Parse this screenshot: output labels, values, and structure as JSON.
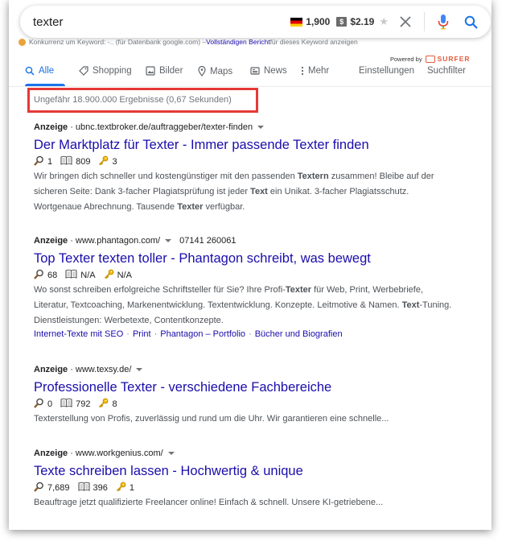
{
  "search": {
    "query": "texter",
    "volume": "1,900",
    "cpc": "$2.19",
    "cpc_badge": "$"
  },
  "competition": {
    "text": "Konkurrenz um Keyword: -.. (für Datenbank google.com) – ",
    "link": "Vollständigen Bericht",
    "suffix": " für dieses Keyword anzeigen"
  },
  "powered_by": {
    "label": "Powered by",
    "brand": "SURFER"
  },
  "tabs": [
    {
      "label": "Alle",
      "icon": "search-icon",
      "active": true
    },
    {
      "label": "Shopping",
      "icon": "tag-icon"
    },
    {
      "label": "Bilder",
      "icon": "image-icon"
    },
    {
      "label": "Maps",
      "icon": "map-pin-icon"
    },
    {
      "label": "News",
      "icon": "news-icon"
    },
    {
      "label": "Mehr",
      "icon": "more-vert-icon"
    }
  ],
  "tools": {
    "settings": "Einstellungen",
    "search_tools": "Suchfilter"
  },
  "stats": "Ungefähr 18.900.000 Ergebnisse (0,67 Sekunden)",
  "results": [
    {
      "label": "Anzeige",
      "url": "ubnc.textbroker.de/auftraggeber/texter-finden",
      "phone": "",
      "title": "Der Marktplatz für Texter - Immer passende Texter finden",
      "metrics": {
        "search": "1",
        "book": "809",
        "key": "3"
      },
      "description": "Wir bringen dich schneller und kostengünstiger mit den passenden <b>Textern</b> zusammen! Bleibe auf der sicheren Seite: Dank 3-facher Plagiatsprüfung ist jeder <b>Text</b> ein Unikat. 3-facher Plagiatsschutz. Wortgenaue Abrechnung. Tausende <b>Texter</b> verfügbar.",
      "sitelinks": []
    },
    {
      "label": "Anzeige",
      "url": "www.phantagon.com/",
      "phone": "07141 260061",
      "title": "Top Texter texten toller - Phantagon schreibt, was bewegt",
      "metrics": {
        "search": "68",
        "book": "N/A",
        "key": "N/A"
      },
      "description": "Wo sonst schreiben erfolgreiche Schriftsteller für Sie? Ihre Profi-<b>Texter</b> für Web, Print, Werbebriefe, Literatur, Textcoaching, Markenentwicklung. Textentwicklung. Konzepte. Leitmotive &amp; Namen. <b>Text</b>-Tuning. Dienstleistungen: Werbetexte, Contentkonzepte.",
      "sitelinks": [
        "Internet-Texte mit SEO",
        "Print",
        "Phantagon – Portfolio",
        "Bücher und Biografien"
      ]
    },
    {
      "label": "Anzeige",
      "url": "www.texsy.de/",
      "phone": "",
      "title": "Professionelle Texter - verschiedene Fachbereiche",
      "metrics": {
        "search": "0",
        "book": "792",
        "key": "8"
      },
      "description": "Texterstellung von Profis, zuverlässig und rund um die Uhr. Wir garantieren eine schnelle...",
      "sitelinks": []
    },
    {
      "label": "Anzeige",
      "url": "www.workgenius.com/",
      "phone": "",
      "title": "Texte schreiben lassen - Hochwertig & unique",
      "metrics": {
        "search": "7,689",
        "book": "396",
        "key": "1"
      },
      "description": "Beauftrage jetzt qualifizierte Freelancer online! Einfach &amp; schnell. Unsere KI-getriebene...",
      "sitelinks": []
    }
  ],
  "colors": {
    "link": "#1a0dab",
    "accent": "#1a73e8",
    "highlight_border": "#e53935",
    "text_secondary": "#70757a"
  }
}
